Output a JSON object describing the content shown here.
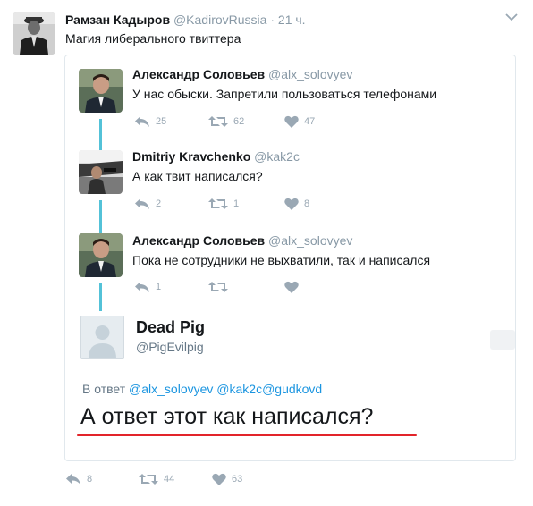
{
  "outer_tweet": {
    "name": "Рамзан Кадыров",
    "handle": "@KadirovRussia",
    "separator": "·",
    "time": "21 ч.",
    "text": "Магия либерального твиттера",
    "actions": {
      "replies": "8",
      "retweets": "44",
      "likes": "63"
    }
  },
  "thread": [
    {
      "name": "Александр Соловьев",
      "handle": "@alx_solovyev",
      "text": "У нас обыски. Запретили пользоваться телефонами",
      "replies": "25",
      "retweets": "62",
      "likes": "47"
    },
    {
      "name": "Dmitriy Kravchenko",
      "handle": "@kak2c",
      "text": "А как твит написался?",
      "replies": "2",
      "retweets": "1",
      "likes": "8"
    },
    {
      "name": "Александр Соловьев",
      "handle": "@alx_solovyev",
      "text": "Пока не сотрудники не выхватили, так и написался",
      "replies": "1",
      "retweets": "",
      "likes": ""
    }
  ],
  "reply": {
    "name": "Dead Pig",
    "handle": "@PigEvilpig",
    "reply_to_prefix": "В ответ",
    "reply_to_handles": "@alx_solovyev @kak2c@gudkovd",
    "text": "А ответ этот как написался?"
  },
  "colors": {
    "accent_link": "#1b95e0",
    "thread_line": "#53c2d8",
    "underline_red": "#e2242a"
  }
}
